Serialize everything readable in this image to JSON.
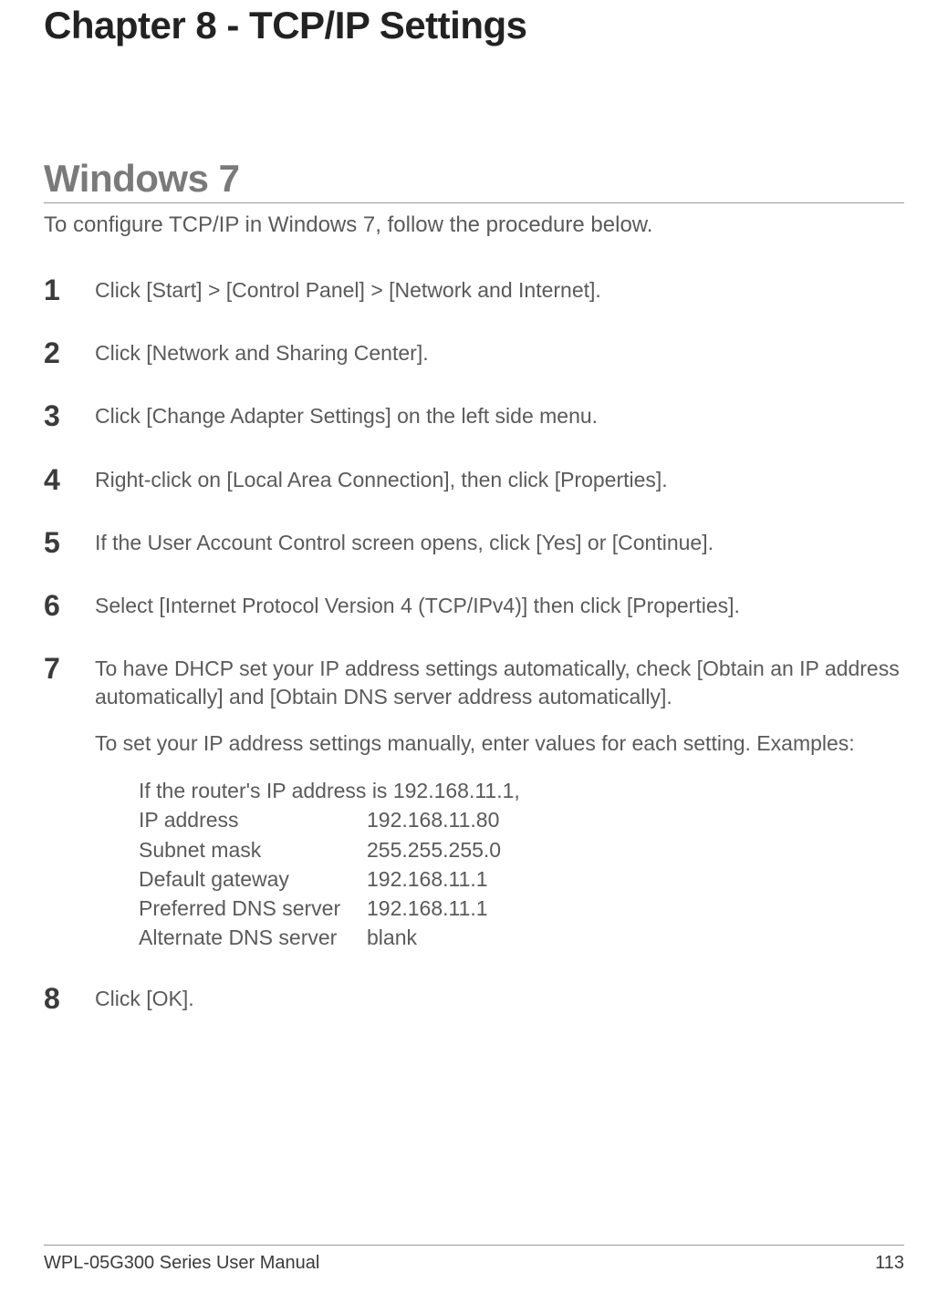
{
  "chapter_title": "Chapter 8 - TCP/IP Settings",
  "section_title": "Windows 7",
  "intro": "To configure TCP/IP in Windows 7, follow the procedure below.",
  "steps": [
    {
      "num": "1",
      "text": "Click [Start] > [Control Panel] > [Network and Internet]."
    },
    {
      "num": "2",
      "text": "Click [Network and Sharing Center]."
    },
    {
      "num": "3",
      "text": "Click [Change Adapter Settings] on the left side menu."
    },
    {
      "num": "4",
      "text": "Right-click on [Local Area Connection], then click [Properties]."
    },
    {
      "num": "5",
      "text": "If the User Account Control screen opens, click [Yes] or [Continue]."
    },
    {
      "num": "6",
      "text": "Select [Internet Protocol Version 4 (TCP/IPv4)] then click [Properties]."
    }
  ],
  "step7": {
    "num": "7",
    "para1": "To have DHCP set your IP address settings automatically, check [Obtain an IP address automatically] and [Obtain DNS server address automatically].",
    "para2": "To set your IP address settings manually, enter values for each setting.  Examples:",
    "example_intro": "If the router's IP address is 192.168.11.1,",
    "examples": [
      {
        "label": "IP address",
        "value": "192.168.11.80"
      },
      {
        "label": "Subnet mask",
        "value": "255.255.255.0"
      },
      {
        "label": "Default gateway",
        "value": "192.168.11.1"
      },
      {
        "label": "Preferred DNS server",
        "value": "192.168.11.1"
      },
      {
        "label": "Alternate DNS server",
        "value": "blank"
      }
    ]
  },
  "step8": {
    "num": "8",
    "text": "Click [OK]."
  },
  "footer": {
    "left": "WPL-05G300 Series User Manual",
    "right": "113"
  }
}
